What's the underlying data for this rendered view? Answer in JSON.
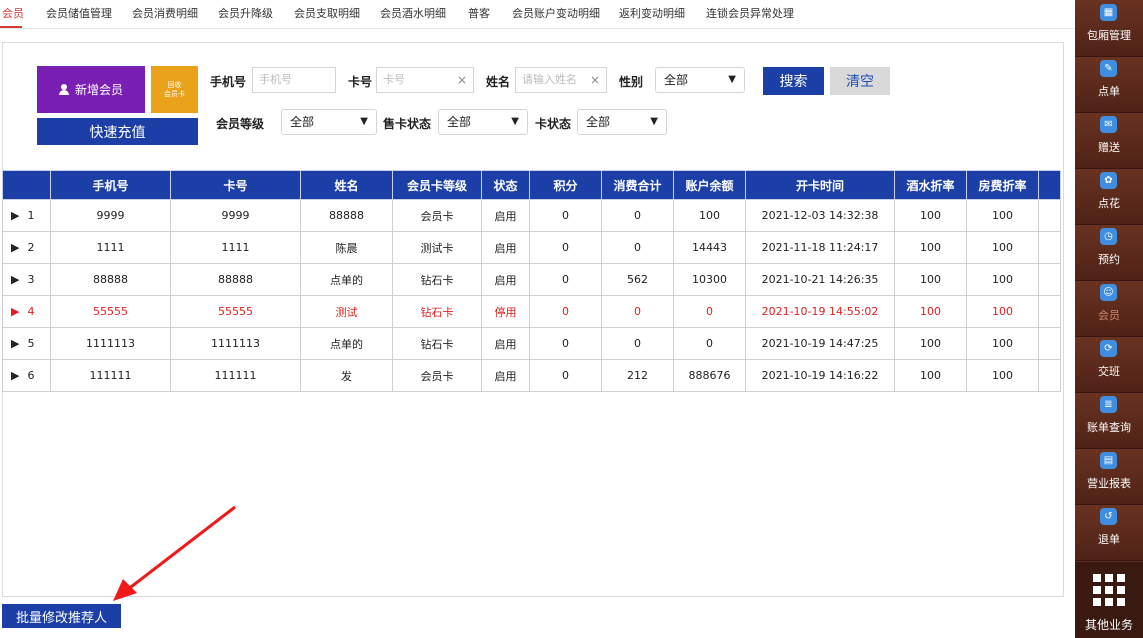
{
  "tabs": [
    "会员",
    "会员储值管理",
    "会员消费明细",
    "会员升降级",
    "会员支取明细",
    "会员酒水明细",
    "普客",
    "会员账户变动明细",
    "返利变动明细",
    "连锁会员异常处理"
  ],
  "actions": {
    "add_member": "新增会员",
    "recycle_card": "回收\n会员卡",
    "quick_recharge": "快速充值"
  },
  "filters": {
    "phone_label": "手机号",
    "phone_placeholder": "手机号",
    "card_label": "卡号",
    "card_placeholder": "卡号",
    "name_label": "姓名",
    "name_placeholder": "请输入姓名",
    "gender_label": "性别",
    "gender_value": "全部",
    "level_label": "会员等级",
    "level_value": "全部",
    "sale_status_label": "售卡状态",
    "sale_status_value": "全部",
    "card_status_label": "卡状态",
    "card_status_value": "全部",
    "clear_icon": "×",
    "dropdown_icon": "▼",
    "search_button": "搜索",
    "clear_button": "清空"
  },
  "table": {
    "headers": [
      "",
      "手机号",
      "卡号",
      "姓名",
      "会员卡等级",
      "状态",
      "积分",
      "消费合计",
      "账户余额",
      "开卡时间",
      "酒水折率",
      "房费折率",
      ""
    ],
    "rows": [
      [
        "1",
        "9999",
        "9999",
        "88888",
        "会员卡",
        "启用",
        "0",
        "0",
        "100",
        "2021-12-03 14:32:38",
        "100",
        "100"
      ],
      [
        "2",
        "1111",
        "1111",
        "陈晨",
        "测试卡",
        "启用",
        "0",
        "0",
        "14443",
        "2021-11-18 11:24:17",
        "100",
        "100"
      ],
      [
        "3",
        "88888",
        "88888",
        "点单的",
        "钻石卡",
        "启用",
        "0",
        "562",
        "10300",
        "2021-10-21 14:26:35",
        "100",
        "100"
      ],
      [
        "4",
        "55555",
        "55555",
        "测试",
        "钻石卡",
        "停用",
        "0",
        "0",
        "0",
        "2021-10-19 14:55:02",
        "100",
        "100"
      ],
      [
        "5",
        "1111113",
        "1111113",
        "点单的",
        "钻石卡",
        "启用",
        "0",
        "0",
        "0",
        "2021-10-19 14:47:25",
        "100",
        "100"
      ],
      [
        "6",
        "111111",
        "111111",
        "发",
        "会员卡",
        "启用",
        "0",
        "212",
        "888676",
        "2021-10-19 14:16:22",
        "100",
        "100"
      ]
    ],
    "row_marker": "▶"
  },
  "batch_button": "批量修改推荐人",
  "sidebar": {
    "items": [
      {
        "label": "包厢管理",
        "icon": "room-icon",
        "glyph": "▦"
      },
      {
        "label": "点单",
        "icon": "order-icon",
        "glyph": "✎"
      },
      {
        "label": "赠送",
        "icon": "gift-icon",
        "glyph": "✉"
      },
      {
        "label": "点花",
        "icon": "flower-icon",
        "glyph": "✿"
      },
      {
        "label": "预约",
        "icon": "reserve-icon",
        "glyph": "◷"
      },
      {
        "label": "会员",
        "icon": "member-icon",
        "glyph": "☺"
      },
      {
        "label": "交班",
        "icon": "shift-icon",
        "glyph": "⟳"
      },
      {
        "label": "账单查询",
        "icon": "bill-icon",
        "glyph": "≣"
      },
      {
        "label": "营业报表",
        "icon": "report-icon",
        "glyph": "▤"
      },
      {
        "label": "退单",
        "icon": "refund-icon",
        "glyph": "↺"
      }
    ],
    "other": "其他业务"
  },
  "colors": {
    "accent_blue": "#1b3fa6",
    "purple": "#7a1fb3",
    "orange": "#e9a21a",
    "warning_red": "#e02020",
    "sidebar_brown": "#5a2a1c"
  }
}
